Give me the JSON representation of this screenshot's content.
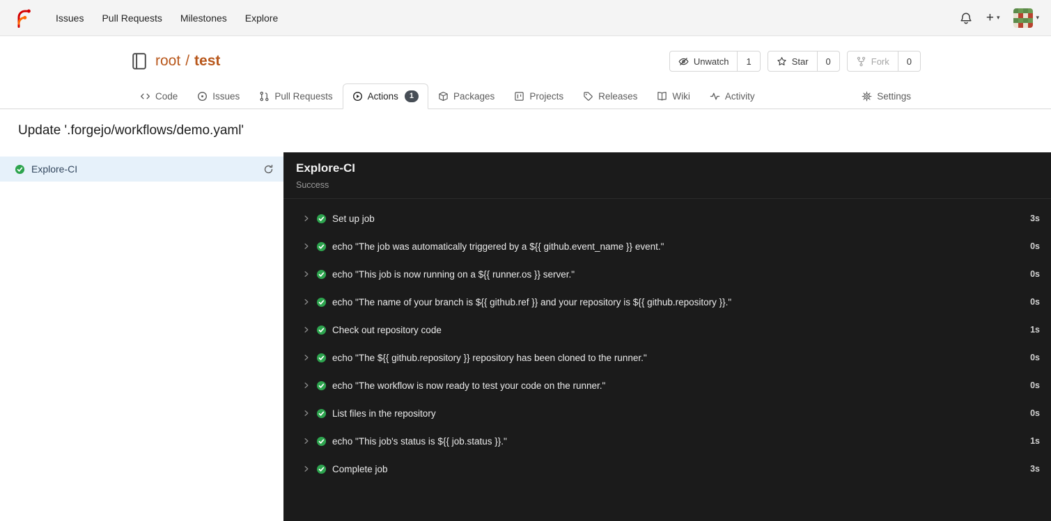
{
  "colors": {
    "brand_red": "#d40000",
    "brand_orange": "#ff6600",
    "link_orange": "#b8571b",
    "success_green": "#2da44e",
    "selected_blue": "#e6f1fa",
    "sidebar_job_text": "#33475e",
    "dark_bg": "#1b1b1b",
    "badge_bg": "#474e56"
  },
  "navbar": {
    "items": [
      {
        "label": "Issues"
      },
      {
        "label": "Pull Requests"
      },
      {
        "label": "Milestones"
      },
      {
        "label": "Explore"
      }
    ]
  },
  "repo": {
    "owner": "root",
    "separator": "/",
    "name": "test",
    "actions": [
      {
        "label": "Unwatch",
        "count": "1"
      },
      {
        "label": "Star",
        "count": "0"
      },
      {
        "label": "Fork",
        "count": "0"
      }
    ]
  },
  "tabs": {
    "items": [
      {
        "label": "Code"
      },
      {
        "label": "Issues"
      },
      {
        "label": "Pull Requests"
      },
      {
        "label": "Actions",
        "badge": "1"
      },
      {
        "label": "Packages"
      },
      {
        "label": "Projects"
      },
      {
        "label": "Releases"
      },
      {
        "label": "Wiki"
      },
      {
        "label": "Activity"
      },
      {
        "label": "Settings"
      }
    ]
  },
  "run": {
    "title": "Update '.forgejo/workflows/demo.yaml'"
  },
  "sidebar": {
    "job_label": "Explore-CI"
  },
  "job_panel": {
    "title": "Explore-CI",
    "status": "Success"
  },
  "steps": [
    {
      "name": "Set up job",
      "duration": "3s"
    },
    {
      "name": "echo \"The job was automatically triggered by a ${{ github.event_name }} event.\"",
      "duration": "0s"
    },
    {
      "name": "echo \"This job is now running on a ${{ runner.os }} server.\"",
      "duration": "0s"
    },
    {
      "name": "echo \"The name of your branch is ${{ github.ref }} and your repository is ${{ github.repository }}.\"",
      "duration": "0s"
    },
    {
      "name": "Check out repository code",
      "duration": "1s"
    },
    {
      "name": "echo \"The ${{ github.repository }} repository has been cloned to the runner.\"",
      "duration": "0s"
    },
    {
      "name": "echo \"The workflow is now ready to test your code on the runner.\"",
      "duration": "0s"
    },
    {
      "name": "List files in the repository",
      "duration": "0s"
    },
    {
      "name": "echo \"This job's status is ${{ job.status }}.\"",
      "duration": "1s"
    },
    {
      "name": "Complete job",
      "duration": "3s"
    }
  ]
}
